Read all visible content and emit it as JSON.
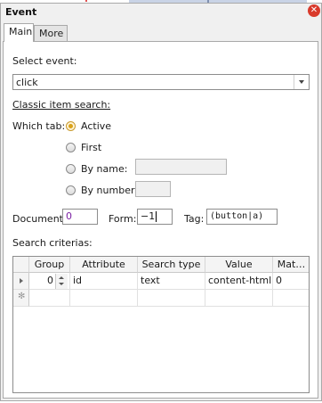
{
  "window": {
    "title": "Event"
  },
  "tabs": [
    {
      "label": "Main"
    },
    {
      "label": "More"
    }
  ],
  "form": {
    "select_event_label": "Select event:",
    "event_value": "click",
    "classic_search_label": "Classic item search:",
    "which_tab_label": "Which tab:",
    "radios": [
      {
        "label": "Active",
        "checked": true
      },
      {
        "label": "First",
        "checked": false
      },
      {
        "label": "By name:",
        "checked": false
      },
      {
        "label": "By number:",
        "checked": false
      }
    ],
    "by_name_value": "",
    "by_number_value": "",
    "document_label": "Document:",
    "document_value": "0",
    "form_label": "Form:",
    "form_value": "−1",
    "tag_label": "Tag:",
    "tag_value": "(button|a)",
    "search_criterias_label": "Search criterias:"
  },
  "grid": {
    "columns": [
      "Group",
      "Attribute",
      "Search type",
      "Value",
      "Mat…"
    ],
    "rows": [
      {
        "group": "0",
        "attribute": "id",
        "search_type": "text",
        "value": "content-html",
        "match": "0"
      }
    ]
  },
  "colors": {
    "accent_radio": "#d9a21a",
    "close": "#d93a2b",
    "purple_text": "#7a1fa2"
  }
}
